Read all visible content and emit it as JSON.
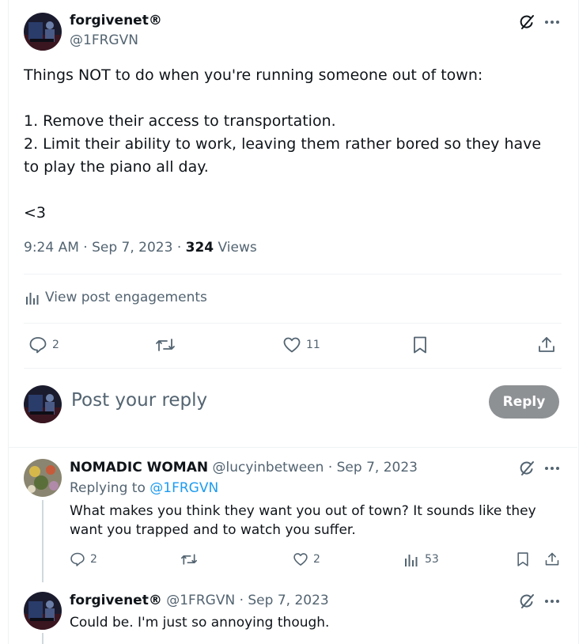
{
  "main_tweet": {
    "author_name": "forgivenet®",
    "handle": "@1FRGVN",
    "body": "Things NOT to do when you're running someone out of town:\n\n1. Remove their access to transportation.\n2. Limit their ability to work, leaving them rather bored so they have to play the piano all day.\n\n<3",
    "time_date": "9:24 AM · Sep 7, 2023 · ",
    "views_count": "324",
    "views_label": "Views",
    "engagements_label": "View post engagements",
    "actions": {
      "replies": "2",
      "likes": "11"
    }
  },
  "compose": {
    "placeholder": "Post your reply",
    "reply_button": "Reply"
  },
  "replies": [
    {
      "author_name": "NOMADIC WOMAN",
      "handle": "@lucyinbetween",
      "date": "· Sep 7, 2023",
      "replying_prefix": "Replying to ",
      "replying_handle": "@1FRGVN",
      "text": "What makes you think they want you out of town? It sounds like they want you trapped and to watch you suffer.",
      "actions": {
        "replies": "2",
        "likes": "2",
        "views": "53"
      }
    },
    {
      "author_name": "forgivenet®",
      "handle": "@1FRGVN",
      "date": "· Sep 7, 2023",
      "text": "Could be. I'm just so annoying though."
    }
  ],
  "colors": {
    "accent": "#1d9bf0",
    "secondary_text": "#536471",
    "reply_button": "#8e9194",
    "divider": "#eff3f4"
  },
  "icons": [
    "grok-icon",
    "more-icon",
    "reply-icon",
    "retweet-icon",
    "like-icon",
    "bookmark-icon",
    "share-icon",
    "analytics-icon"
  ]
}
